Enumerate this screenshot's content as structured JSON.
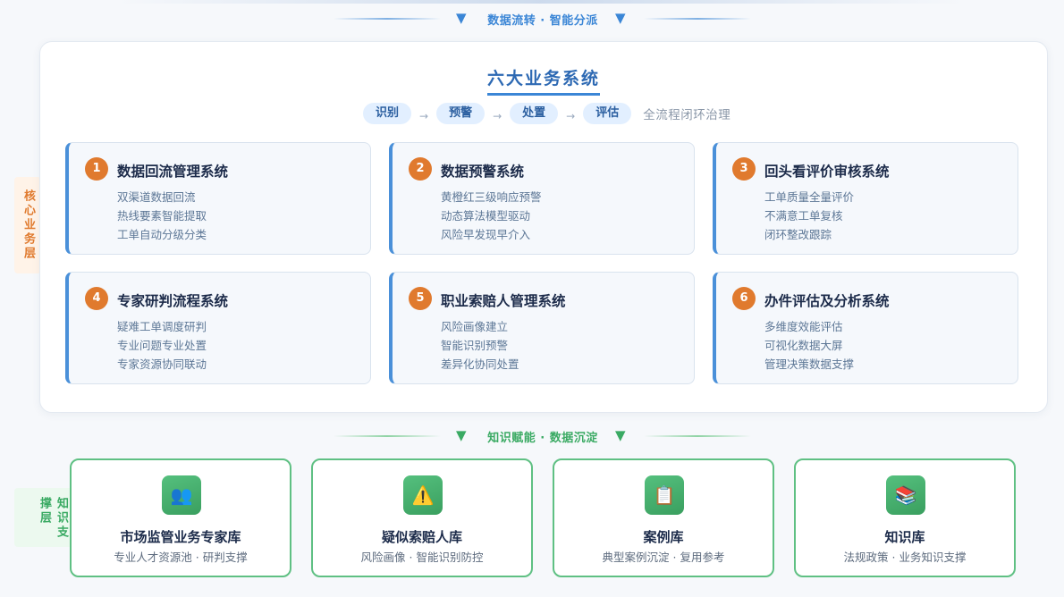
{
  "flow_top": {
    "label": "数据流转 · 智能分派",
    "arrow": "▼"
  },
  "flow_bottom": {
    "label": "知识赋能 · 数据沉淀",
    "arrow": "▼"
  },
  "side_labels": {
    "core": "核心业务层",
    "knowledge": "知识支撑层"
  },
  "main": {
    "title": "六大业务系统",
    "steps": [
      "识别",
      "预警",
      "处置",
      "评估"
    ],
    "step_arrow": "→",
    "step_note": "全流程闭环治理"
  },
  "systems": [
    {
      "num": "1",
      "title": "数据回流管理系统",
      "items": [
        "双渠道数据回流",
        "热线要素智能提取",
        "工单自动分级分类"
      ]
    },
    {
      "num": "2",
      "title": "数据预警系统",
      "items": [
        "黄橙红三级响应预警",
        "动态算法模型驱动",
        "风险早发现早介入"
      ]
    },
    {
      "num": "3",
      "title": "回头看评价审核系统",
      "items": [
        "工单质量全量评价",
        "不满意工单复核",
        "闭环整改跟踪"
      ]
    },
    {
      "num": "4",
      "title": "专家研判流程系统",
      "items": [
        "疑难工单调度研判",
        "专业问题专业处置",
        "专家资源协同联动"
      ]
    },
    {
      "num": "5",
      "title": "职业索赔人管理系统",
      "items": [
        "风险画像建立",
        "智能识别预警",
        "差异化协同处置"
      ]
    },
    {
      "num": "6",
      "title": "办件评估及分析系统",
      "items": [
        "多维度效能评估",
        "可视化数据大屏",
        "管理决策数据支撑"
      ]
    }
  ],
  "knowledge": [
    {
      "icon": "👥",
      "icon_name": "people-icon",
      "title": "市场监管业务专家库",
      "desc": "专业人才资源池 · 研判支撑"
    },
    {
      "icon": "⚠️",
      "icon_name": "warning-icon",
      "title": "疑似索赔人库",
      "desc": "风险画像 · 智能识别防控"
    },
    {
      "icon": "📋",
      "icon_name": "clipboard-icon",
      "title": "案例库",
      "desc": "典型案例沉淀 · 复用参考"
    },
    {
      "icon": "📚",
      "icon_name": "books-icon",
      "title": "知识库",
      "desc": "法规政策 · 业务知识支撑"
    }
  ],
  "colors": {
    "blue": "#3b86d6",
    "orange": "#e07a2e",
    "green": "#3aaa63"
  }
}
